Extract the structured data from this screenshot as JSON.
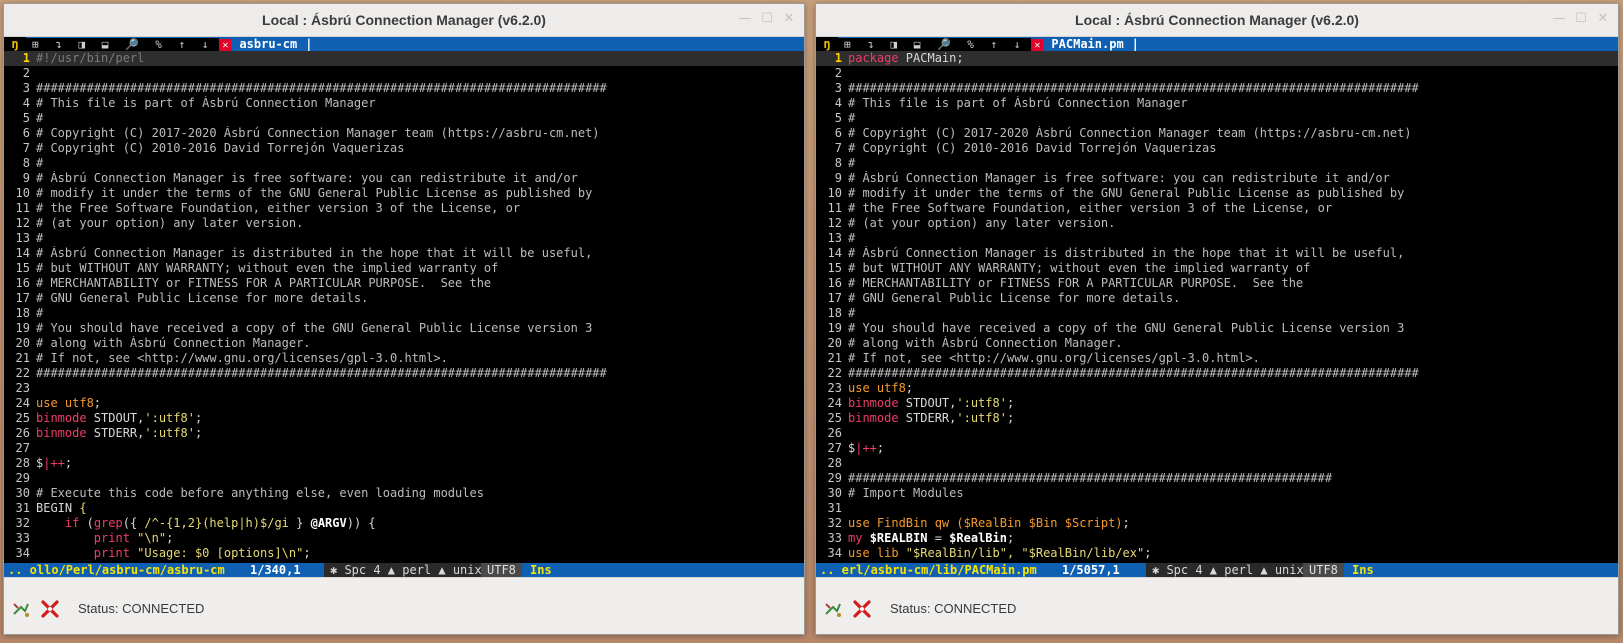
{
  "windows": [
    {
      "title": "Local : Ásbrú Connection Manager (v6.2.0)",
      "tab": {
        "logo": "ŋ",
        "buttons": "⊞ ↴ ◨ ⬓ 🔎 % ↑ ↓",
        "close": "✕",
        "name": "asbru-cm",
        "sep": "|"
      },
      "lines": [
        {
          "n": "1",
          "parts": [
            {
              "c": "c-shebang",
              "t": "#!/usr/bin/perl"
            }
          ]
        },
        {
          "n": "2",
          "parts": []
        },
        {
          "n": "3",
          "parts": [
            {
              "c": "c-comment",
              "t": "###############################################################################"
            }
          ]
        },
        {
          "n": "4",
          "parts": [
            {
              "c": "c-comment",
              "t": "# This file is part of Ásbrú Connection Manager"
            }
          ]
        },
        {
          "n": "5",
          "parts": [
            {
              "c": "c-comment",
              "t": "#"
            }
          ]
        },
        {
          "n": "6",
          "parts": [
            {
              "c": "c-comment",
              "t": "# Copyright (C) 2017-2020 Ásbrú Connection Manager team (https://asbru-cm.net)"
            }
          ]
        },
        {
          "n": "7",
          "parts": [
            {
              "c": "c-comment",
              "t": "# Copyright (C) 2010-2016 David Torrejón Vaquerizas"
            }
          ]
        },
        {
          "n": "8",
          "parts": [
            {
              "c": "c-comment",
              "t": "#"
            }
          ]
        },
        {
          "n": "9",
          "parts": [
            {
              "c": "c-comment",
              "t": "# Ásbrú Connection Manager is free software: you can redistribute it and/or"
            }
          ]
        },
        {
          "n": "10",
          "parts": [
            {
              "c": "c-comment",
              "t": "# modify it under the terms of the GNU General Public License as published by"
            }
          ]
        },
        {
          "n": "11",
          "parts": [
            {
              "c": "c-comment",
              "t": "# the Free Software Foundation, either version 3 of the License, or"
            }
          ]
        },
        {
          "n": "12",
          "parts": [
            {
              "c": "c-comment",
              "t": "# (at your option) any later version."
            }
          ]
        },
        {
          "n": "13",
          "parts": [
            {
              "c": "c-comment",
              "t": "#"
            }
          ]
        },
        {
          "n": "14",
          "parts": [
            {
              "c": "c-comment",
              "t": "# Ásbrú Connection Manager is distributed in the hope that it will be useful,"
            }
          ]
        },
        {
          "n": "15",
          "parts": [
            {
              "c": "c-comment",
              "t": "# but WITHOUT ANY WARRANTY; without even the implied warranty of"
            }
          ]
        },
        {
          "n": "16",
          "parts": [
            {
              "c": "c-comment",
              "t": "# MERCHANTABILITY or FITNESS FOR A PARTICULAR PURPOSE.  See the"
            }
          ]
        },
        {
          "n": "17",
          "parts": [
            {
              "c": "c-comment",
              "t": "# GNU General Public License for more details."
            }
          ]
        },
        {
          "n": "18",
          "parts": [
            {
              "c": "c-comment",
              "t": "#"
            }
          ]
        },
        {
          "n": "19",
          "parts": [
            {
              "c": "c-comment",
              "t": "# You should have received a copy of the GNU General Public License version 3"
            }
          ]
        },
        {
          "n": "20",
          "parts": [
            {
              "c": "c-comment",
              "t": "# along with Ásbrú Connection Manager."
            }
          ]
        },
        {
          "n": "21",
          "parts": [
            {
              "c": "c-comment",
              "t": "# If not, see <http://www.gnu.org/licenses/gpl-3.0.html>."
            }
          ]
        },
        {
          "n": "22",
          "parts": [
            {
              "c": "c-comment",
              "t": "###############################################################################"
            }
          ]
        },
        {
          "n": "23",
          "parts": []
        },
        {
          "n": "24",
          "parts": [
            {
              "c": "c-use",
              "t": "use utf8"
            },
            {
              "c": "",
              "t": ";"
            }
          ]
        },
        {
          "n": "25",
          "parts": [
            {
              "c": "c-kw",
              "t": "binmode"
            },
            {
              "c": "",
              "t": " STDOUT,"
            },
            {
              "c": "c-str",
              "t": "':utf8'"
            },
            {
              "c": "",
              "t": ";"
            }
          ]
        },
        {
          "n": "26",
          "parts": [
            {
              "c": "c-kw",
              "t": "binmode"
            },
            {
              "c": "",
              "t": " STDERR,"
            },
            {
              "c": "c-str",
              "t": "':utf8'"
            },
            {
              "c": "",
              "t": ";"
            }
          ]
        },
        {
          "n": "27",
          "parts": []
        },
        {
          "n": "28",
          "parts": [
            {
              "c": "",
              "t": "$"
            },
            {
              "c": "c-op",
              "t": "|++"
            },
            {
              "c": "",
              "t": ";"
            }
          ]
        },
        {
          "n": "29",
          "parts": []
        },
        {
          "n": "30",
          "parts": [
            {
              "c": "c-comment",
              "t": "# Execute this code before anything else, even loading modules"
            }
          ]
        },
        {
          "n": "31",
          "parts": [
            {
              "c": "",
              "t": "BEGIN "
            },
            {
              "c": "c-str",
              "t": "{"
            }
          ]
        },
        {
          "n": "32",
          "parts": [
            {
              "c": "",
              "t": "    "
            },
            {
              "c": "c-kw",
              "t": "if"
            },
            {
              "c": "",
              "t": " ("
            },
            {
              "c": "c-kw",
              "t": "grep"
            },
            {
              "c": "",
              "t": "({ "
            },
            {
              "c": "c-str",
              "t": "/^-{1,2}(help|h)$/gi"
            },
            {
              "c": "",
              "t": " } "
            },
            {
              "c": "c-var",
              "t": "@ARGV"
            },
            {
              "c": "",
              "t": ")) {"
            }
          ]
        },
        {
          "n": "33",
          "parts": [
            {
              "c": "",
              "t": "        "
            },
            {
              "c": "c-kw",
              "t": "print"
            },
            {
              "c": "",
              "t": " "
            },
            {
              "c": "c-str",
              "t": "\"\\n\""
            },
            {
              "c": "",
              "t": ";"
            }
          ]
        },
        {
          "n": "34",
          "parts": [
            {
              "c": "",
              "t": "        "
            },
            {
              "c": "c-kw",
              "t": "print"
            },
            {
              "c": "",
              "t": " "
            },
            {
              "c": "c-str",
              "t": "\"Usage: $0 [options]\\n\""
            },
            {
              "c": "",
              "t": ";"
            }
          ]
        }
      ],
      "statusline": {
        "path": ".. ollo/Perl/asbru-cm/asbru-cm",
        "pos": "1/340,1",
        "segments": "✱ Spc 4 ▲ perl ▲ unix",
        "enc": "UTF8",
        "mode": "Ins"
      },
      "status": "Status: CONNECTED"
    },
    {
      "title": "Local : Ásbrú Connection Manager (v6.2.0)",
      "tab": {
        "logo": "ŋ",
        "buttons": "⊞ ↴ ◨ ⬓ 🔎 % ↑ ↓",
        "close": "✕",
        "name": "PACMain.pm",
        "sep": "|"
      },
      "lines": [
        {
          "n": "1",
          "parts": [
            {
              "c": "c-kw",
              "t": "package"
            },
            {
              "c": "",
              "t": " PACMain;"
            }
          ]
        },
        {
          "n": "2",
          "parts": []
        },
        {
          "n": "3",
          "parts": [
            {
              "c": "c-comment",
              "t": "###############################################################################"
            }
          ]
        },
        {
          "n": "4",
          "parts": [
            {
              "c": "c-comment",
              "t": "# This file is part of Ásbrú Connection Manager"
            }
          ]
        },
        {
          "n": "5",
          "parts": [
            {
              "c": "c-comment",
              "t": "#"
            }
          ]
        },
        {
          "n": "6",
          "parts": [
            {
              "c": "c-comment",
              "t": "# Copyright (C) 2017-2020 Ásbrú Connection Manager team (https://asbru-cm.net)"
            }
          ]
        },
        {
          "n": "7",
          "parts": [
            {
              "c": "c-comment",
              "t": "# Copyright (C) 2010-2016 David Torrejón Vaquerizas"
            }
          ]
        },
        {
          "n": "8",
          "parts": [
            {
              "c": "c-comment",
              "t": "#"
            }
          ]
        },
        {
          "n": "9",
          "parts": [
            {
              "c": "c-comment",
              "t": "# Ásbrú Connection Manager is free software: you can redistribute it and/or"
            }
          ]
        },
        {
          "n": "10",
          "parts": [
            {
              "c": "c-comment",
              "t": "# modify it under the terms of the GNU General Public License as published by"
            }
          ]
        },
        {
          "n": "11",
          "parts": [
            {
              "c": "c-comment",
              "t": "# the Free Software Foundation, either version 3 of the License, or"
            }
          ]
        },
        {
          "n": "12",
          "parts": [
            {
              "c": "c-comment",
              "t": "# (at your option) any later version."
            }
          ]
        },
        {
          "n": "13",
          "parts": [
            {
              "c": "c-comment",
              "t": "#"
            }
          ]
        },
        {
          "n": "14",
          "parts": [
            {
              "c": "c-comment",
              "t": "# Ásbrú Connection Manager is distributed in the hope that it will be useful,"
            }
          ]
        },
        {
          "n": "15",
          "parts": [
            {
              "c": "c-comment",
              "t": "# but WITHOUT ANY WARRANTY; without even the implied warranty of"
            }
          ]
        },
        {
          "n": "16",
          "parts": [
            {
              "c": "c-comment",
              "t": "# MERCHANTABILITY or FITNESS FOR A PARTICULAR PURPOSE.  See the"
            }
          ]
        },
        {
          "n": "17",
          "parts": [
            {
              "c": "c-comment",
              "t": "# GNU General Public License for more details."
            }
          ]
        },
        {
          "n": "18",
          "parts": [
            {
              "c": "c-comment",
              "t": "#"
            }
          ]
        },
        {
          "n": "19",
          "parts": [
            {
              "c": "c-comment",
              "t": "# You should have received a copy of the GNU General Public License version 3"
            }
          ]
        },
        {
          "n": "20",
          "parts": [
            {
              "c": "c-comment",
              "t": "# along with Ásbrú Connection Manager."
            }
          ]
        },
        {
          "n": "21",
          "parts": [
            {
              "c": "c-comment",
              "t": "# If not, see <http://www.gnu.org/licenses/gpl-3.0.html>."
            }
          ]
        },
        {
          "n": "22",
          "parts": [
            {
              "c": "c-comment",
              "t": "###############################################################################"
            }
          ]
        },
        {
          "n": "23",
          "parts": [
            {
              "c": "c-use",
              "t": "use utf8"
            },
            {
              "c": "",
              "t": ";"
            }
          ]
        },
        {
          "n": "24",
          "parts": [
            {
              "c": "c-kw",
              "t": "binmode"
            },
            {
              "c": "",
              "t": " STDOUT,"
            },
            {
              "c": "c-str",
              "t": "':utf8'"
            },
            {
              "c": "",
              "t": ";"
            }
          ]
        },
        {
          "n": "25",
          "parts": [
            {
              "c": "c-kw",
              "t": "binmode"
            },
            {
              "c": "",
              "t": " STDERR,"
            },
            {
              "c": "c-str",
              "t": "':utf8'"
            },
            {
              "c": "",
              "t": ";"
            }
          ]
        },
        {
          "n": "26",
          "parts": []
        },
        {
          "n": "27",
          "parts": [
            {
              "c": "",
              "t": "$"
            },
            {
              "c": "c-op",
              "t": "|++"
            },
            {
              "c": "",
              "t": ";"
            }
          ]
        },
        {
          "n": "28",
          "parts": []
        },
        {
          "n": "29",
          "parts": [
            {
              "c": "c-comment",
              "t": "###################################################################"
            }
          ]
        },
        {
          "n": "30",
          "parts": [
            {
              "c": "c-comment",
              "t": "# Import Modules"
            }
          ]
        },
        {
          "n": "31",
          "parts": []
        },
        {
          "n": "32",
          "parts": [
            {
              "c": "c-use",
              "t": "use FindBin qw ($RealBin $Bin $Script)"
            },
            {
              "c": "",
              "t": ";"
            }
          ]
        },
        {
          "n": "33",
          "parts": [
            {
              "c": "c-kw",
              "t": "my"
            },
            {
              "c": "",
              "t": " "
            },
            {
              "c": "c-var",
              "t": "$REALBIN"
            },
            {
              "c": "",
              "t": " = "
            },
            {
              "c": "c-var",
              "t": "$RealBin"
            },
            {
              "c": "",
              "t": ";"
            }
          ]
        },
        {
          "n": "34",
          "parts": [
            {
              "c": "c-use",
              "t": "use lib "
            },
            {
              "c": "c-str",
              "t": "\"$RealBin/lib\", \"$RealBin/lib/ex\""
            },
            {
              "c": "",
              "t": ";"
            }
          ]
        }
      ],
      "statusline": {
        "path": ".. erl/asbru-cm/lib/PACMain.pm",
        "pos": "1/5057,1",
        "segments": "✱ Spc 4 ▲ perl ▲ unix",
        "enc": "UTF8",
        "mode": "Ins"
      },
      "status": "Status: CONNECTED"
    }
  ]
}
